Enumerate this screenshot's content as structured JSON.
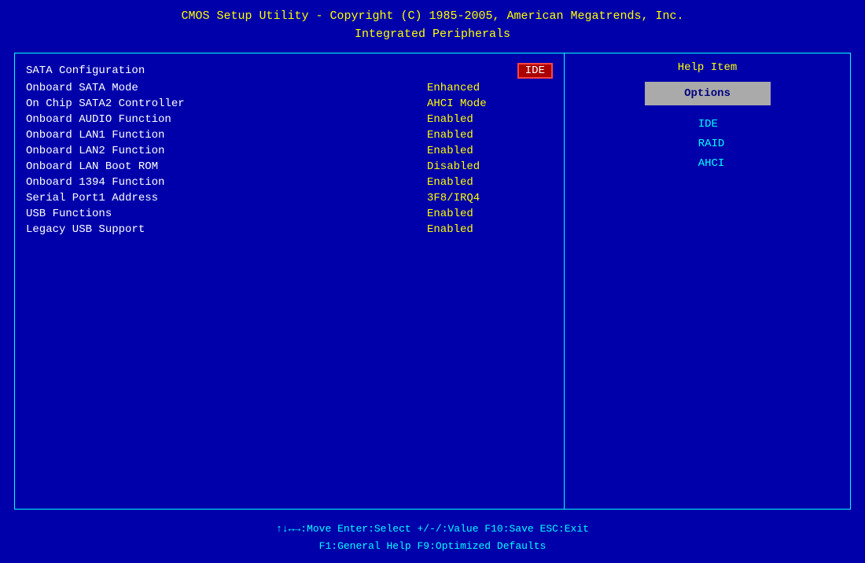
{
  "header": {
    "line1": "CMOS Setup Utility - Copyright (C) 1985-2005, American Megatrends, Inc.",
    "line2": "Integrated Peripherals"
  },
  "menu": {
    "items": [
      {
        "label": "SATA Configuration",
        "value": "IDE",
        "selected": true
      },
      {
        "label": "Onboard SATA Mode",
        "value": "Enhanced",
        "selected": false
      },
      {
        "label": "On Chip SATA2 Controller",
        "value": "AHCI Mode",
        "selected": false
      },
      {
        "label": "Onboard AUDIO Function",
        "value": "Enabled",
        "selected": false
      },
      {
        "label": "Onboard LAN1 Function",
        "value": "Enabled",
        "selected": false
      },
      {
        "label": "Onboard LAN2 Function",
        "value": "Enabled",
        "selected": false
      },
      {
        "label": "Onboard LAN Boot ROM",
        "value": "Disabled",
        "selected": false
      },
      {
        "label": "Onboard 1394 Function",
        "value": "Enabled",
        "selected": false
      },
      {
        "label": "Serial Port1 Address",
        "value": "3F8/IRQ4",
        "selected": false
      },
      {
        "label": "USB Functions",
        "value": "Enabled",
        "selected": false
      },
      {
        "label": "Legacy USB Support",
        "value": "Enabled",
        "selected": false
      }
    ]
  },
  "help_panel": {
    "title": "Help Item",
    "options_label": "Options",
    "options": [
      "IDE",
      "RAID",
      "AHCI"
    ]
  },
  "footer": {
    "line1_parts": [
      {
        "text": "↑↓↔→:Move",
        "highlight": false
      },
      {
        "text": "  Enter:Select",
        "highlight": false
      },
      {
        "text": "  +/-/:Value",
        "highlight": false
      },
      {
        "text": "  F10:Save",
        "highlight": false
      },
      {
        "text": "  ESC:Exit",
        "highlight": false
      }
    ],
    "line2_parts": [
      {
        "text": "F1:General Help",
        "highlight": false
      },
      {
        "text": "                F9:Optimized Defaults",
        "highlight": false
      }
    ],
    "line1": "↑↓↔→:Move   Enter:Select   +/-/:Value   F10:Save   ESC:Exit",
    "line2": "F1:General Help                    F9:Optimized Defaults"
  }
}
